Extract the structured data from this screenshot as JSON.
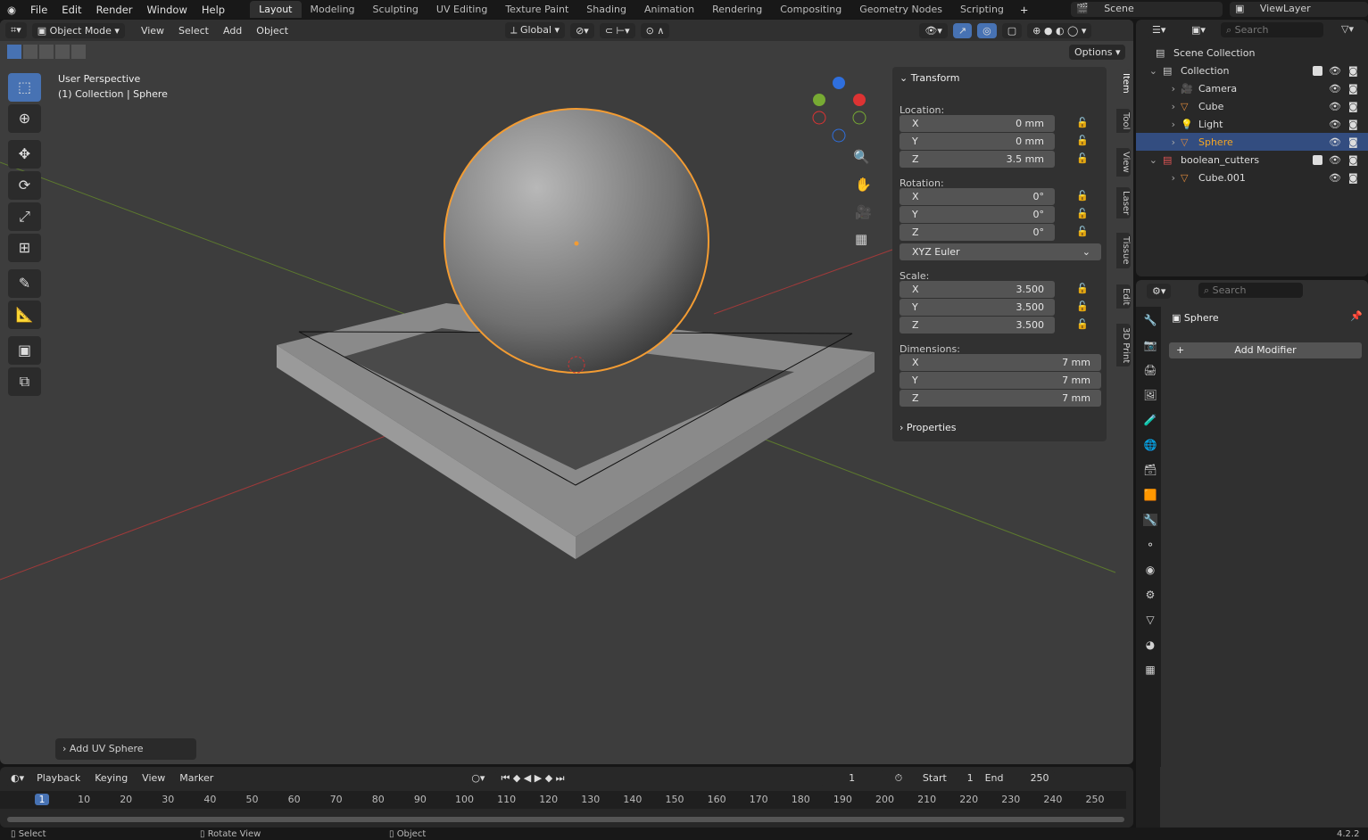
{
  "topbar": {
    "menus": [
      "File",
      "Edit",
      "Render",
      "Window",
      "Help"
    ],
    "workspaces": [
      "Layout",
      "Modeling",
      "Sculpting",
      "UV Editing",
      "Texture Paint",
      "Shading",
      "Animation",
      "Rendering",
      "Compositing",
      "Geometry Nodes",
      "Scripting"
    ],
    "active_workspace": "Layout",
    "scene": "Scene",
    "view_layer": "ViewLayer"
  },
  "viewport": {
    "mode": "Object Mode",
    "menus": [
      "View",
      "Select",
      "Add",
      "Object"
    ],
    "orientation": "Global",
    "options": "Options",
    "info_line1": "User Perspective",
    "info_line2": "(1) Collection | Sphere",
    "last_op": "Add UV Sphere",
    "accent": "#4772b3",
    "selection_color": "#f39c33"
  },
  "npanel": {
    "transform": "Transform",
    "location_label": "Location:",
    "location": [
      {
        "axis": "X",
        "value": "0 mm"
      },
      {
        "axis": "Y",
        "value": "0 mm"
      },
      {
        "axis": "Z",
        "value": "3.5 mm"
      }
    ],
    "rotation_label": "Rotation:",
    "rotation": [
      {
        "axis": "X",
        "value": "0°"
      },
      {
        "axis": "Y",
        "value": "0°"
      },
      {
        "axis": "Z",
        "value": "0°"
      }
    ],
    "rotation_mode": "XYZ Euler",
    "scale_label": "Scale:",
    "scale": [
      {
        "axis": "X",
        "value": "3.500"
      },
      {
        "axis": "Y",
        "value": "3.500"
      },
      {
        "axis": "Z",
        "value": "3.500"
      }
    ],
    "dimensions_label": "Dimensions:",
    "dimensions": [
      {
        "axis": "X",
        "value": "7 mm"
      },
      {
        "axis": "Y",
        "value": "7 mm"
      },
      {
        "axis": "Z",
        "value": "7 mm"
      }
    ],
    "properties": "Properties",
    "tabs": [
      "Item",
      "Tool",
      "View",
      "Laser",
      "Tissue",
      "Edit",
      "3D Print"
    ]
  },
  "outliner": {
    "search_placeholder": "Search",
    "rows": [
      {
        "label": "Scene Collection"
      },
      {
        "label": "Collection"
      },
      {
        "label": "Camera"
      },
      {
        "label": "Cube"
      },
      {
        "label": "Light"
      },
      {
        "label": "Sphere",
        "selected": true
      },
      {
        "label": "boolean_cutters"
      },
      {
        "label": "Cube.001"
      }
    ]
  },
  "properties": {
    "search_placeholder": "Search",
    "object": "Sphere",
    "add_modifier": "Add Modifier"
  },
  "timeline": {
    "menus": [
      "Playback",
      "Keying",
      "View",
      "Marker"
    ],
    "current_frame": "1",
    "start_label": "Start",
    "start": "1",
    "end_label": "End",
    "end": "250",
    "ticks": [
      "1",
      "10",
      "20",
      "30",
      "40",
      "50",
      "60",
      "70",
      "80",
      "90",
      "100",
      "110",
      "120",
      "130",
      "140",
      "150",
      "160",
      "170",
      "180",
      "190",
      "200",
      "210",
      "220",
      "230",
      "240",
      "250"
    ]
  },
  "status": {
    "select": "Select",
    "rotate": "Rotate View",
    "object": "Object",
    "version": "4.2.2"
  }
}
